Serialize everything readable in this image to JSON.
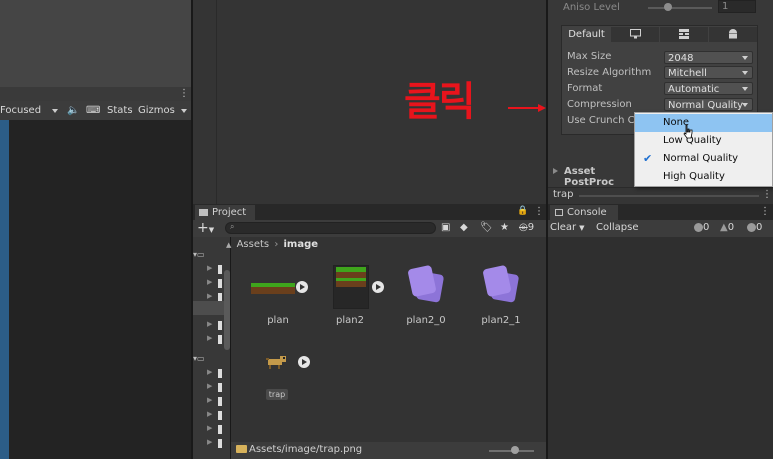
{
  "game_toolbar": {
    "focused_label": "Focused",
    "stats_label": "Stats",
    "gizmos_label": "Gizmos"
  },
  "inspector": {
    "aniso_label": "Aniso Level",
    "aniso_value": "1",
    "platform_tabs": [
      {
        "label": "Default",
        "icon": "default-tab"
      },
      {
        "label": "",
        "icon": "monitor-icon"
      },
      {
        "label": "",
        "icon": "grid-icon"
      },
      {
        "label": "",
        "icon": "android-icon"
      }
    ],
    "properties": [
      {
        "label": "Max Size",
        "value": "2048"
      },
      {
        "label": "Resize Algorithm",
        "value": "Mitchell"
      },
      {
        "label": "Format",
        "value": "Automatic"
      },
      {
        "label": "Compression",
        "value": "Normal Quality"
      },
      {
        "label": "Use Crunch Co",
        "value": ""
      }
    ],
    "asset_postprocessor_label": "Asset PostProc",
    "footer_name": "trap"
  },
  "annotation": {
    "korean_text": "클릭",
    "arrow": "→"
  },
  "compression_menu": {
    "options": [
      {
        "label": "None",
        "hovered": true,
        "checked": false
      },
      {
        "label": "Low Quality",
        "hovered": false,
        "checked": false
      },
      {
        "label": "Normal Quality",
        "hovered": false,
        "checked": true
      },
      {
        "label": "High Quality",
        "hovered": false,
        "checked": false
      }
    ]
  },
  "project": {
    "tab_label": "Project",
    "add_label": "+",
    "hidden_count": "9",
    "breadcrumb": [
      "Assets",
      "image"
    ],
    "assets": [
      {
        "name": "plan",
        "kind": "grass-strip"
      },
      {
        "name": "plan2",
        "kind": "grass-block"
      },
      {
        "name": "plan2_0",
        "kind": "sprite-icon"
      },
      {
        "name": "plan2_1",
        "kind": "sprite-icon"
      },
      {
        "name": "trap",
        "kind": "dog-sprite"
      }
    ],
    "footer_path": "Assets/image/trap.png"
  },
  "console": {
    "tab_label": "Console",
    "clear_label": "Clear",
    "collapse_label": "Collapse",
    "log_count": "0",
    "warning_count": "0",
    "error_count": "0"
  },
  "colors": {
    "accent_blue": "#2c5d87",
    "hover_blue": "#8ec4f2",
    "annotation_red": "#e8141c",
    "menu_bg": "#efefef"
  }
}
